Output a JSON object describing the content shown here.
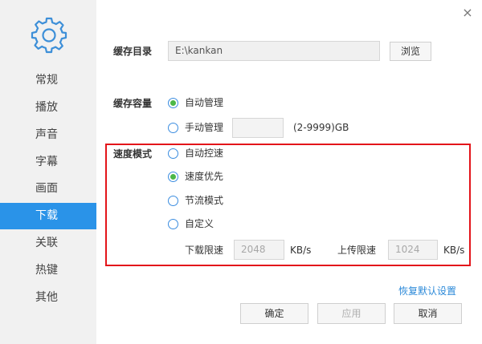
{
  "sidebar": {
    "icon": "gear-icon",
    "items": [
      {
        "label": "常规"
      },
      {
        "label": "播放"
      },
      {
        "label": "声音"
      },
      {
        "label": "字幕"
      },
      {
        "label": "画面"
      },
      {
        "label": "下载",
        "active": true
      },
      {
        "label": "关联"
      },
      {
        "label": "热键"
      },
      {
        "label": "其他"
      }
    ],
    "active_color": "#2a93e8"
  },
  "window": {
    "close_icon": "close-icon",
    "close_glyph": "×"
  },
  "cache_dir": {
    "label": "缓存目录",
    "value": "E:\\kankan",
    "browse_label": "浏览"
  },
  "cache_size": {
    "label": "缓存容量",
    "auto_label": "自动管理",
    "manual_label": "手动管理",
    "manual_value": "",
    "range_text": "(2-9999)GB",
    "selected": "auto"
  },
  "speed_mode": {
    "label": "速度模式",
    "options": [
      {
        "label": "自动控速",
        "checked": false
      },
      {
        "label": "速度优先",
        "checked": true
      },
      {
        "label": "节流模式",
        "checked": false
      },
      {
        "label": "自定义",
        "checked": false
      }
    ],
    "download_limit_label": "下载限速",
    "download_limit_value": "2048",
    "upload_limit_label": "上传限速",
    "upload_limit_value": "1024",
    "unit": "KB/s",
    "highlight_color": "#e3141a"
  },
  "restore_defaults": "恢复默认设置",
  "footer": {
    "ok_label": "确定",
    "apply_label": "应用",
    "cancel_label": "取消"
  }
}
